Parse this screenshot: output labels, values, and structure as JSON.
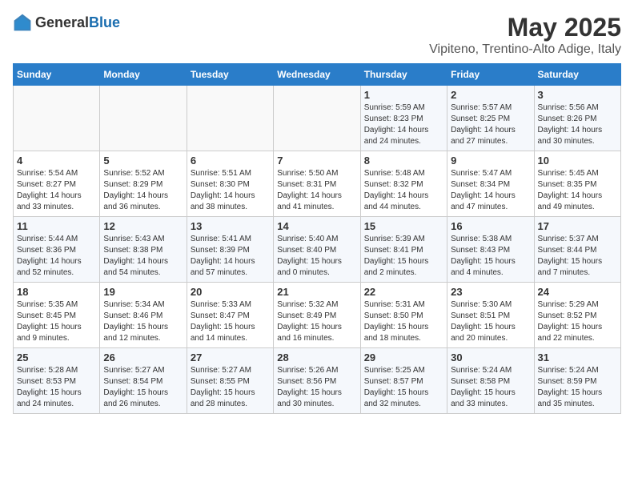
{
  "header": {
    "logo_general": "General",
    "logo_blue": "Blue",
    "month_title": "May 2025",
    "location": "Vipiteno, Trentino-Alto Adige, Italy"
  },
  "days_of_week": [
    "Sunday",
    "Monday",
    "Tuesday",
    "Wednesday",
    "Thursday",
    "Friday",
    "Saturday"
  ],
  "weeks": [
    [
      {
        "day": "",
        "info": ""
      },
      {
        "day": "",
        "info": ""
      },
      {
        "day": "",
        "info": ""
      },
      {
        "day": "",
        "info": ""
      },
      {
        "day": "1",
        "info": "Sunrise: 5:59 AM\nSunset: 8:23 PM\nDaylight: 14 hours and 24 minutes."
      },
      {
        "day": "2",
        "info": "Sunrise: 5:57 AM\nSunset: 8:25 PM\nDaylight: 14 hours and 27 minutes."
      },
      {
        "day": "3",
        "info": "Sunrise: 5:56 AM\nSunset: 8:26 PM\nDaylight: 14 hours and 30 minutes."
      }
    ],
    [
      {
        "day": "4",
        "info": "Sunrise: 5:54 AM\nSunset: 8:27 PM\nDaylight: 14 hours and 33 minutes."
      },
      {
        "day": "5",
        "info": "Sunrise: 5:52 AM\nSunset: 8:29 PM\nDaylight: 14 hours and 36 minutes."
      },
      {
        "day": "6",
        "info": "Sunrise: 5:51 AM\nSunset: 8:30 PM\nDaylight: 14 hours and 38 minutes."
      },
      {
        "day": "7",
        "info": "Sunrise: 5:50 AM\nSunset: 8:31 PM\nDaylight: 14 hours and 41 minutes."
      },
      {
        "day": "8",
        "info": "Sunrise: 5:48 AM\nSunset: 8:32 PM\nDaylight: 14 hours and 44 minutes."
      },
      {
        "day": "9",
        "info": "Sunrise: 5:47 AM\nSunset: 8:34 PM\nDaylight: 14 hours and 47 minutes."
      },
      {
        "day": "10",
        "info": "Sunrise: 5:45 AM\nSunset: 8:35 PM\nDaylight: 14 hours and 49 minutes."
      }
    ],
    [
      {
        "day": "11",
        "info": "Sunrise: 5:44 AM\nSunset: 8:36 PM\nDaylight: 14 hours and 52 minutes."
      },
      {
        "day": "12",
        "info": "Sunrise: 5:43 AM\nSunset: 8:38 PM\nDaylight: 14 hours and 54 minutes."
      },
      {
        "day": "13",
        "info": "Sunrise: 5:41 AM\nSunset: 8:39 PM\nDaylight: 14 hours and 57 minutes."
      },
      {
        "day": "14",
        "info": "Sunrise: 5:40 AM\nSunset: 8:40 PM\nDaylight: 15 hours and 0 minutes."
      },
      {
        "day": "15",
        "info": "Sunrise: 5:39 AM\nSunset: 8:41 PM\nDaylight: 15 hours and 2 minutes."
      },
      {
        "day": "16",
        "info": "Sunrise: 5:38 AM\nSunset: 8:43 PM\nDaylight: 15 hours and 4 minutes."
      },
      {
        "day": "17",
        "info": "Sunrise: 5:37 AM\nSunset: 8:44 PM\nDaylight: 15 hours and 7 minutes."
      }
    ],
    [
      {
        "day": "18",
        "info": "Sunrise: 5:35 AM\nSunset: 8:45 PM\nDaylight: 15 hours and 9 minutes."
      },
      {
        "day": "19",
        "info": "Sunrise: 5:34 AM\nSunset: 8:46 PM\nDaylight: 15 hours and 12 minutes."
      },
      {
        "day": "20",
        "info": "Sunrise: 5:33 AM\nSunset: 8:47 PM\nDaylight: 15 hours and 14 minutes."
      },
      {
        "day": "21",
        "info": "Sunrise: 5:32 AM\nSunset: 8:49 PM\nDaylight: 15 hours and 16 minutes."
      },
      {
        "day": "22",
        "info": "Sunrise: 5:31 AM\nSunset: 8:50 PM\nDaylight: 15 hours and 18 minutes."
      },
      {
        "day": "23",
        "info": "Sunrise: 5:30 AM\nSunset: 8:51 PM\nDaylight: 15 hours and 20 minutes."
      },
      {
        "day": "24",
        "info": "Sunrise: 5:29 AM\nSunset: 8:52 PM\nDaylight: 15 hours and 22 minutes."
      }
    ],
    [
      {
        "day": "25",
        "info": "Sunrise: 5:28 AM\nSunset: 8:53 PM\nDaylight: 15 hours and 24 minutes."
      },
      {
        "day": "26",
        "info": "Sunrise: 5:27 AM\nSunset: 8:54 PM\nDaylight: 15 hours and 26 minutes."
      },
      {
        "day": "27",
        "info": "Sunrise: 5:27 AM\nSunset: 8:55 PM\nDaylight: 15 hours and 28 minutes."
      },
      {
        "day": "28",
        "info": "Sunrise: 5:26 AM\nSunset: 8:56 PM\nDaylight: 15 hours and 30 minutes."
      },
      {
        "day": "29",
        "info": "Sunrise: 5:25 AM\nSunset: 8:57 PM\nDaylight: 15 hours and 32 minutes."
      },
      {
        "day": "30",
        "info": "Sunrise: 5:24 AM\nSunset: 8:58 PM\nDaylight: 15 hours and 33 minutes."
      },
      {
        "day": "31",
        "info": "Sunrise: 5:24 AM\nSunset: 8:59 PM\nDaylight: 15 hours and 35 minutes."
      }
    ]
  ]
}
